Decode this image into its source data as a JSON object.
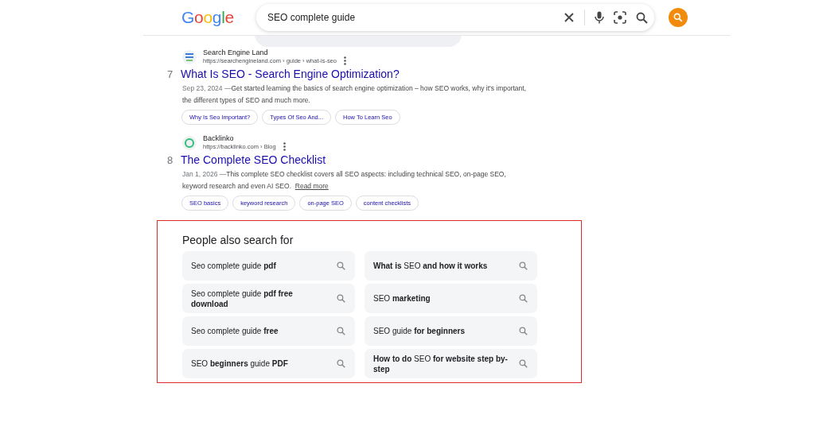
{
  "logo": "Google",
  "search": {
    "query": "SEO complete guide"
  },
  "results": [
    {
      "rank": "7",
      "kind": "square",
      "site": "Search Engine Land",
      "url": "https://searchengineland.com › guide › what-is-seo",
      "title": "What Is SEO - Search Engine Optimization?",
      "date": "Sep 23, 2024 —",
      "snippet": "Get started learning the basics of search engine optimization – how SEO works, why it's important, the different types of SEO and much more.",
      "chips": [
        "Why Is Seo Important?",
        "Types Of Seo And...",
        "How To Learn Seo"
      ]
    },
    {
      "rank": "8",
      "kind": "ring",
      "site": "Backlinko",
      "url": "https://backlinko.com › Blog",
      "title": "The Complete SEO Checklist",
      "date": "Jan 1, 2026 —",
      "snippet": "This complete SEO checklist covers all SEO aspects: including technical SEO, on-page SEO, keyword research and even AI SEO.",
      "read_more": "Read more",
      "chips": [
        "SEO basics",
        "keyword research",
        "on-page SEO",
        "content checklists"
      ]
    }
  ],
  "people_also_search": {
    "heading": "People also search for",
    "items": [
      "Seo complete guide **pdf**",
      "**What is** SEO **and how it works**",
      "Seo complete guide **pdf free download**",
      "SEO **marketing**",
      "Seo complete guide **free**",
      "SEO guide **for beginners**",
      "SEO **beginners** guide **PDF**",
      "**How to do** SEO **for website step by-step**"
    ]
  }
}
